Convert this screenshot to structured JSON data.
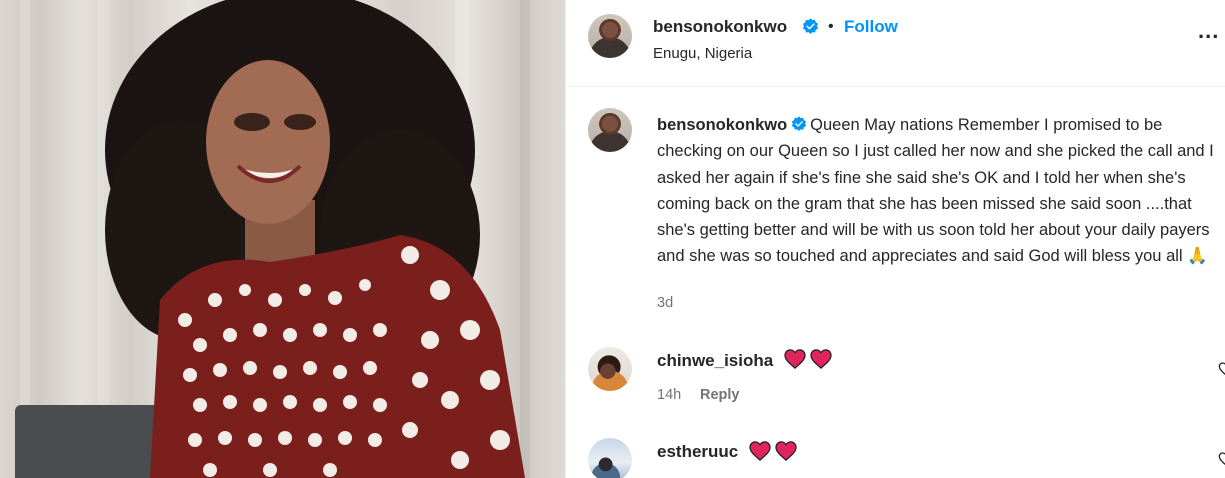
{
  "post": {
    "author": "bensonokonkwo",
    "follow_label": "Follow",
    "separator": "•",
    "location": "Enugu, Nigeria",
    "more_label": "...",
    "image_icon": "photo-of-woman",
    "caption_author": "bensonokonkwo",
    "caption_text": "Queen May nations Remember I promised to be checking on our Queen so I just called her now and she picked the call and I asked her again if she's fine she said she's OK and I told her when she's coming back on the gram that she has been missed she said soon ....that she's getting better and will be with us soon told her about your daily payers and she was so touched and appreciates and said God will bless you all 🙏",
    "caption_time": "3d"
  },
  "comments": [
    {
      "username": "chinwe_isioha",
      "text": "❤️❤️",
      "time": "14h",
      "reply_label": "Reply"
    },
    {
      "username": "estheruuc",
      "text": "❤️❤️"
    }
  ],
  "colors": {
    "accent": "#0095f6",
    "verified": "#0095f6",
    "heart": "#e0245e",
    "muted": "#737373"
  }
}
